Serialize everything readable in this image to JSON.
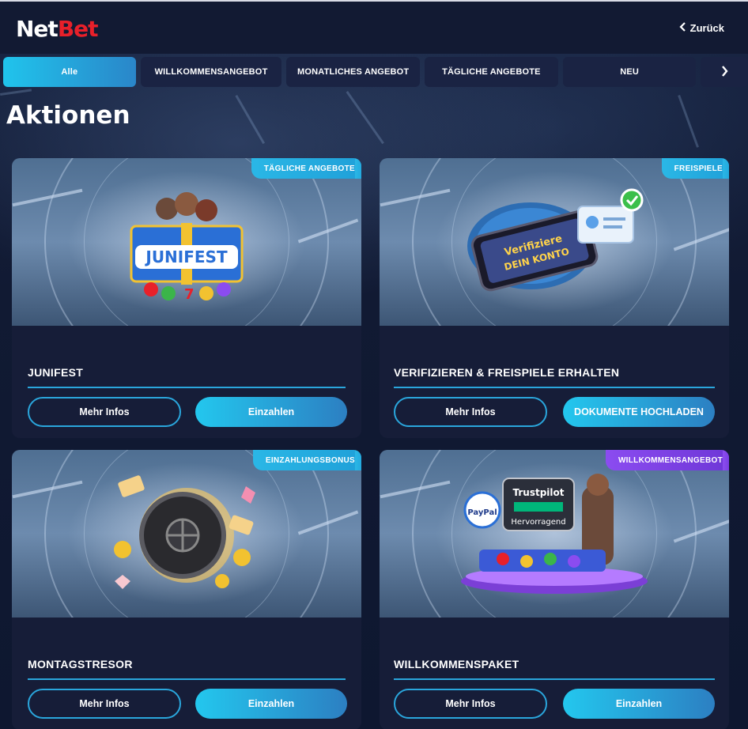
{
  "header": {
    "logo_part1": "Net",
    "logo_part2": "Bet",
    "back_label": "Zurück"
  },
  "tabs": [
    {
      "label": "Alle",
      "active": true
    },
    {
      "label": "WILLKOMMENSANGEBOT",
      "active": false
    },
    {
      "label": "MONATLICHES ANGEBOT",
      "active": false
    },
    {
      "label": "TÄGLICHE ANGEBOTE",
      "active": false
    },
    {
      "label": "NEU",
      "active": false
    }
  ],
  "page_title": "Aktionen",
  "cards": [
    {
      "badge": "TÄGLICHE ANGEBOTE",
      "badge_color": "#2ab7e6",
      "name": "JUNIFEST",
      "image_text": "JUNIFEST",
      "secondary_button": "Mehr Infos",
      "primary_button": "Einzahlen"
    },
    {
      "badge": "FREISPIELE",
      "badge_color": "#2ab7e6",
      "name": "VERIFIZIEREN & FREISPIELE ERHALTEN",
      "image_text": "Verifiziere DEIN KONTO",
      "secondary_button": "Mehr Infos",
      "primary_button": "DOKUMENTE HOCHLADEN"
    },
    {
      "badge": "EINZAHLUNGSBONUS",
      "badge_color": "#2ab7e6",
      "name": "MONTAGSTRESOR",
      "secondary_button": "Mehr Infos",
      "primary_button": "Einzahlen"
    },
    {
      "badge": "WILLKOMMENSANGEBOT",
      "badge_color": "#8b4cf0",
      "name": "WILLKOMMENSPAKET",
      "image_text_1": "Trustpilot",
      "image_text_2": "Hervorragend",
      "image_text_3": "PayPal",
      "secondary_button": "Mehr Infos",
      "primary_button": "Einzahlen"
    }
  ],
  "colors": {
    "accent": "#2aa6dc",
    "brand_red": "#e8202a",
    "background": "#0f1a35",
    "card": "#161d38"
  }
}
